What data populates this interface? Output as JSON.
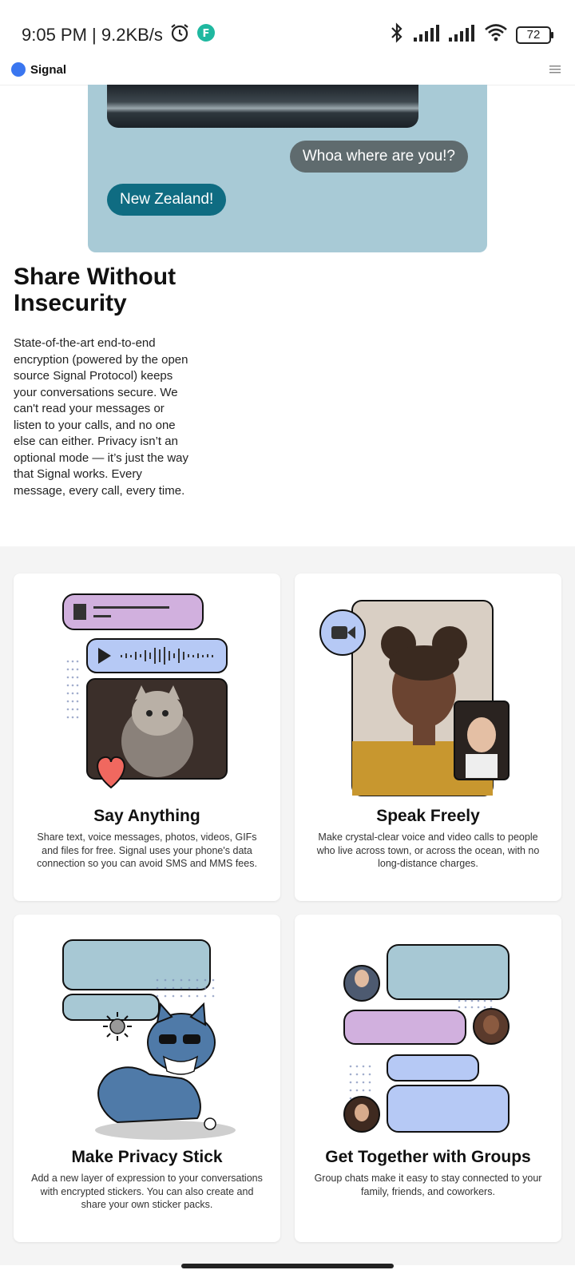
{
  "status": {
    "time_speed": "9:05 PM | 9.2KB/s",
    "battery": "72"
  },
  "app": {
    "brand": "Signal",
    "menu_icon": "hamburger-icon"
  },
  "hero": {
    "bubble_reply": "Whoa where are you!?",
    "bubble_sent": "New Zealand!"
  },
  "section": {
    "title": "Share Without Insecurity",
    "body": "State-of-the-art end-to-end encryption (powered by the open source Signal Protocol) keeps your conversations secure. We can't read your messages or listen to your calls, and no one else can either. Privacy isn’t an optional mode — it’s just the way that Signal works. Every message, every call, every time."
  },
  "features": [
    {
      "title": "Say Anything",
      "text": "Share text, voice messages, photos, videos, GIFs and files for free. Signal uses your phone's data connection so you can avoid SMS and MMS fees."
    },
    {
      "title": "Speak Freely",
      "text": "Make crystal-clear voice and video calls to people who live across town, or across the ocean, with no long-distance charges."
    },
    {
      "title": "Make Privacy Stick",
      "text": "Add a new layer of expression to your conversations with encrypted stickers. You can also create and share your own sticker packs."
    },
    {
      "title": "Get Together with Groups",
      "text": "Group chats make it easy to stay connected to your family, friends, and coworkers."
    }
  ]
}
